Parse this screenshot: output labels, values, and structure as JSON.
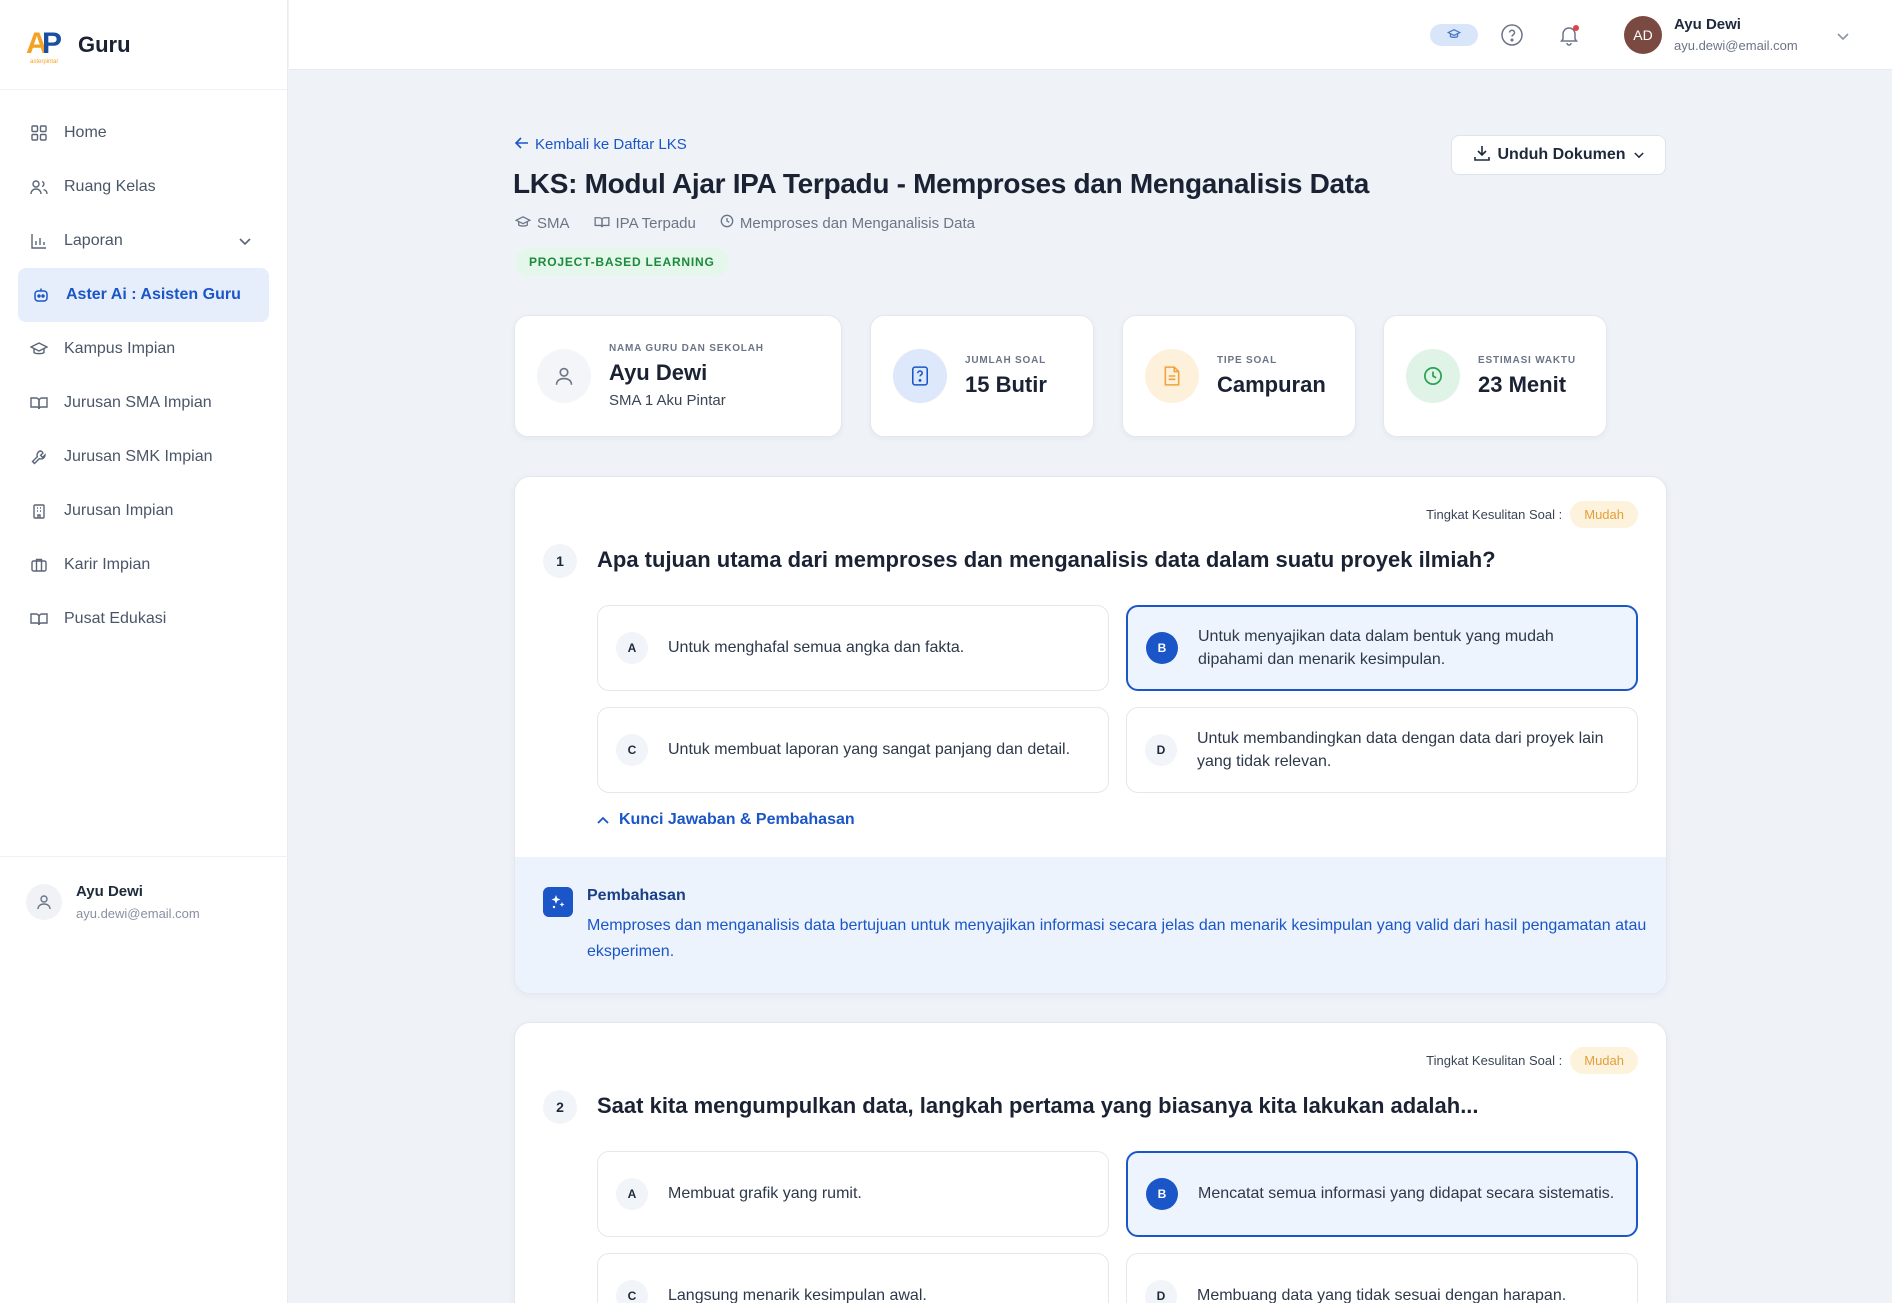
{
  "brand": {
    "mark_a": "A",
    "mark_p": "P",
    "mark_sub": "asterpintar",
    "name": "Guru"
  },
  "sidebar": {
    "items": [
      {
        "label": "Home"
      },
      {
        "label": "Ruang Kelas"
      },
      {
        "label": "Laporan"
      },
      {
        "label": "Aster Ai : Asisten Guru"
      },
      {
        "label": "Kampus Impian"
      },
      {
        "label": "Jurusan SMA Impian"
      },
      {
        "label": "Jurusan SMK Impian"
      },
      {
        "label": "Jurusan Impian"
      },
      {
        "label": "Karir Impian"
      },
      {
        "label": "Pusat Edukasi"
      }
    ],
    "user": {
      "name": "Ayu Dewi",
      "email": "ayu.dewi@email.com"
    }
  },
  "topbar": {
    "avatar_initials": "AD",
    "name": "Ayu Dewi",
    "email": "ayu.dewi@email.com"
  },
  "page": {
    "back_label": "Kembali ke Daftar LKS",
    "title": "LKS: Modul Ajar IPA Terpadu - Memproses dan Menganalisis Data",
    "meta": {
      "level": "SMA",
      "subject": "IPA Terpadu",
      "topic": "Memproses dan Menganalisis Data"
    },
    "badge": "PROJECT-BASED LEARNING",
    "download_label": "Unduh Dokumen"
  },
  "stats": {
    "teacher": {
      "label": "NAMA GURU DAN SEKOLAH",
      "value": "Ayu Dewi",
      "sub": "SMA 1 Aku Pintar"
    },
    "count": {
      "label": "JUMLAH SOAL",
      "value": "15 Butir"
    },
    "type": {
      "label": "TIPE SOAL",
      "value": "Campuran"
    },
    "time": {
      "label": "ESTIMASI WAKTU",
      "value": "23 Menit"
    }
  },
  "questions": [
    {
      "difficulty_label": "Tingkat Kesulitan Soal :",
      "difficulty": "Mudah",
      "number": "1",
      "text": "Apa tujuan utama dari memproses dan menganalisis data dalam suatu proyek ilmiah?",
      "options": [
        {
          "letter": "A",
          "text": "Untuk menghafal semua angka dan fakta."
        },
        {
          "letter": "B",
          "text": "Untuk menyajikan data dalam bentuk yang mudah dipahami dan menarik kesimpulan."
        },
        {
          "letter": "C",
          "text": "Untuk membuat laporan yang sangat panjang dan detail."
        },
        {
          "letter": "D",
          "text": "Untuk membandingkan data dengan data dari proyek lain yang tidak relevan."
        }
      ],
      "answer_toggle": "Kunci Jawaban & Pembahasan",
      "explanation_title": "Pembahasan",
      "explanation": "Memproses dan menganalisis data bertujuan untuk menyajikan informasi secara jelas dan menarik kesimpulan yang valid dari hasil pengamatan atau eksperimen."
    },
    {
      "difficulty_label": "Tingkat Kesulitan Soal :",
      "difficulty": "Mudah",
      "number": "2",
      "text": "Saat kita mengumpulkan data, langkah pertama yang biasanya kita lakukan adalah...",
      "options": [
        {
          "letter": "A",
          "text": "Membuat grafik yang rumit."
        },
        {
          "letter": "B",
          "text": "Mencatat semua informasi yang didapat secara sistematis."
        },
        {
          "letter": "C",
          "text": "Langsung menarik kesimpulan awal."
        },
        {
          "letter": "D",
          "text": "Membuang data yang tidak sesuai dengan harapan."
        }
      ]
    }
  ],
  "colors": {
    "accent": "#1a56c8",
    "brand_orange": "#f4a223",
    "success": "#1b8a3d",
    "difficulty": "#e2a03a"
  }
}
